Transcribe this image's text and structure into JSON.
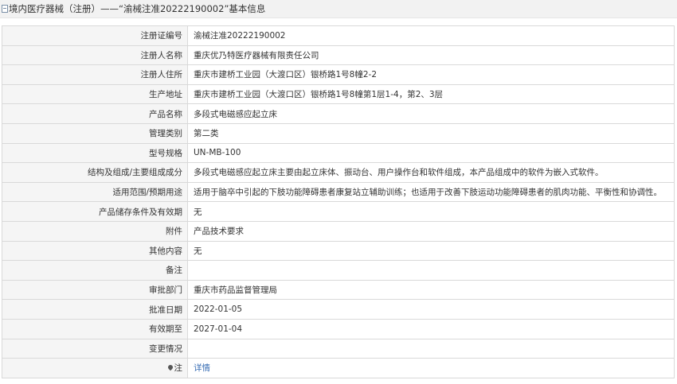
{
  "header": {
    "title": "境内医疗器械（注册）——“渝械注准20222190002”基本信息"
  },
  "rows": [
    {
      "label": "注册证编号",
      "value": "渝械注准20222190002"
    },
    {
      "label": "注册人名称",
      "value": "重庆优乃特医疗器械有限责任公司"
    },
    {
      "label": "注册人住所",
      "value": "重庆市建桥工业园（大渡口区）银桥路1号8幢2-2"
    },
    {
      "label": "生产地址",
      "value": "重庆市建桥工业园（大渡口区）银桥路1号8幢第1层1-4，第2、3层"
    },
    {
      "label": "产品名称",
      "value": "多段式电磁感应起立床"
    },
    {
      "label": "管理类别",
      "value": "第二类"
    },
    {
      "label": "型号规格",
      "value": "UN-MB-100"
    },
    {
      "label": "结构及组成/主要组成成分",
      "value": "多段式电磁感应起立床主要由起立床体、振动台、用户操作台和软件组成，本产品组成中的软件为嵌入式软件。"
    },
    {
      "label": "适用范围/预期用途",
      "value": "适用于脑卒中引起的下肢功能障碍患者康复站立辅助训练；也适用于改善下肢运动功能障碍患者的肌肉功能、平衡性和协调性。"
    },
    {
      "label": "产品储存条件及有效期",
      "value": "无"
    },
    {
      "label": "附件",
      "value": "产品技术要求"
    },
    {
      "label": "其他内容",
      "value": "无"
    },
    {
      "label": "备注",
      "value": ""
    },
    {
      "label": "审批部门",
      "value": "重庆市药品监督管理局"
    },
    {
      "label": "批准日期",
      "value": "2022-01-05"
    },
    {
      "label": "有效期至",
      "value": "2027-01-04"
    },
    {
      "label": "变更情况",
      "value": ""
    }
  ],
  "note_row": {
    "label": "注",
    "icon": "map-pin-icon",
    "link": "详情"
  }
}
